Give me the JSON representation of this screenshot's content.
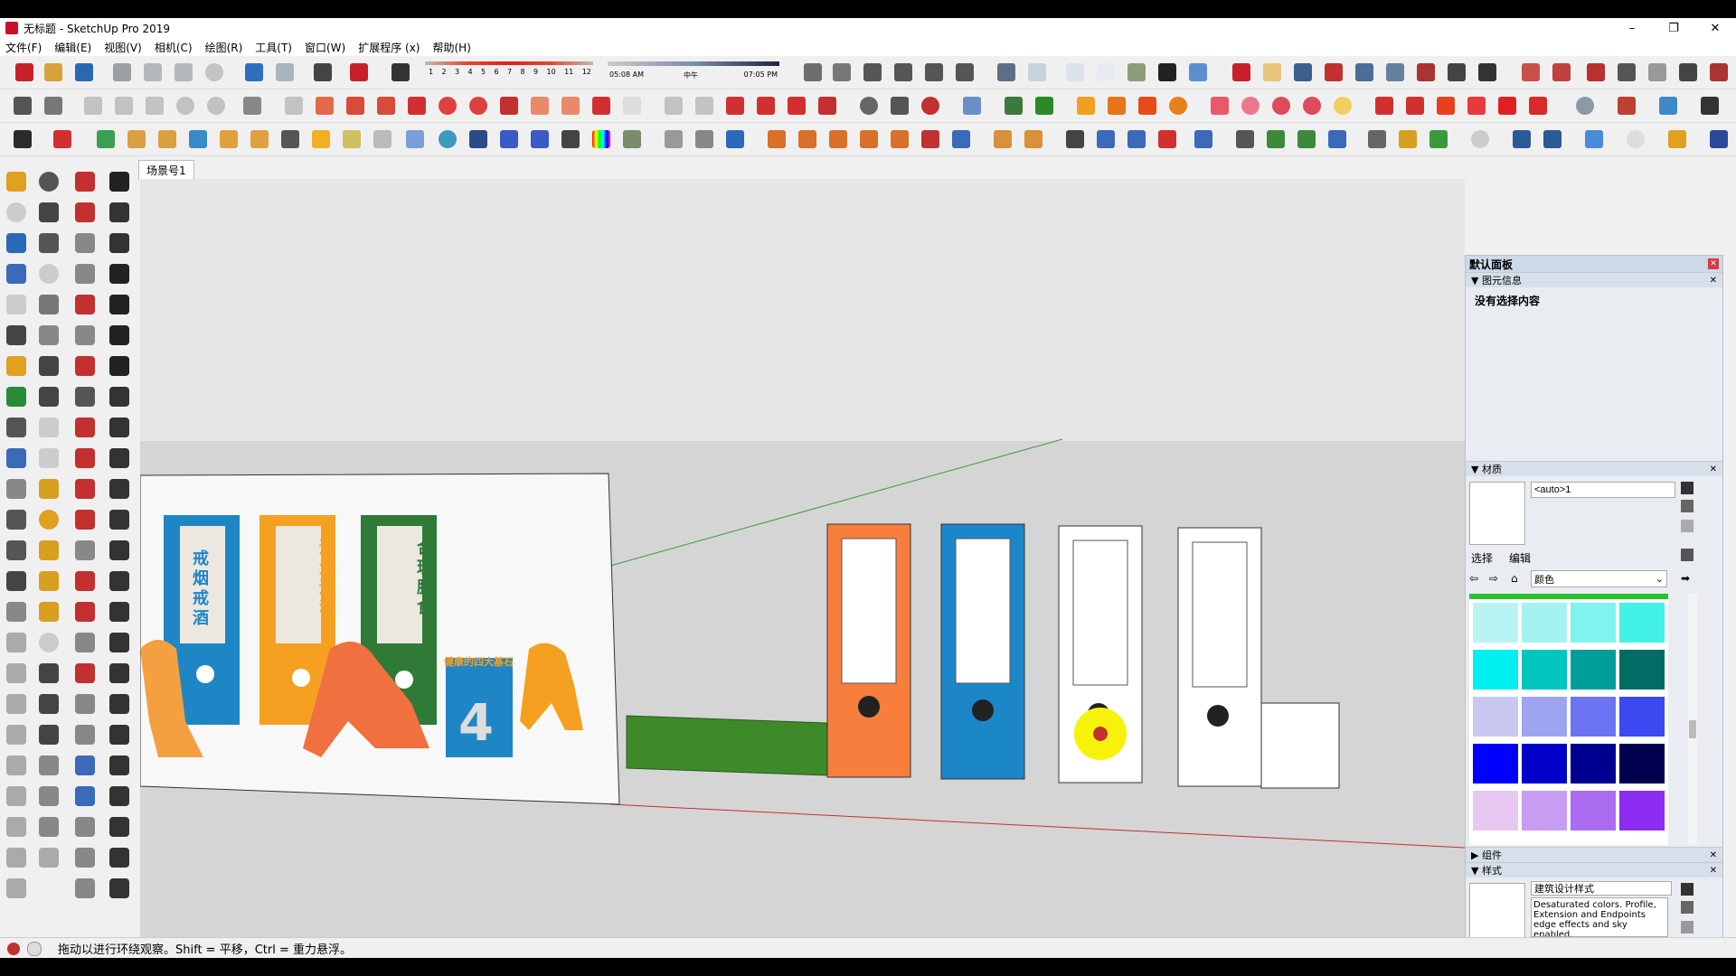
{
  "window": {
    "title": "无标题 - SketchUp Pro 2019",
    "minimize": "–",
    "maximize": "❐",
    "close": "✕"
  },
  "menu": [
    "文件(F)",
    "编辑(E)",
    "视图(V)",
    "相机(C)",
    "绘图(R)",
    "工具(T)",
    "窗口(W)",
    "扩展程序 (x)",
    "帮助(H)"
  ],
  "shadow": {
    "months": [
      "1",
      "2",
      "3",
      "4",
      "5",
      "6",
      "7",
      "8",
      "9",
      "10",
      "11",
      "12"
    ],
    "time_start": "05:08 AM",
    "time_mid": "中午",
    "time_end": "07:05 PM"
  },
  "scene_tab": "场景号1",
  "panel": {
    "title": "默认面板",
    "entity_info": {
      "header": "图元信息",
      "content": "没有选择内容"
    },
    "materials": {
      "header": "材质",
      "material_name": "<auto>1",
      "tabs": [
        "选择",
        "编辑"
      ],
      "library": "颜色"
    },
    "components": {
      "header": "组件"
    },
    "styles": {
      "header": "样式",
      "style_name": "建筑设计样式",
      "style_desc": "Desaturated colors. Profile, Extension and Endpoints edge effects and sky enabled."
    }
  },
  "board_text": {
    "panel1": "戒烟戒酒",
    "panel2": "适量运动",
    "panel3": "合理膳食",
    "banner": "健康的四大基石",
    "number": "4"
  },
  "status": {
    "text": "拖动以进行环绕观察。Shift = 平移，Ctrl = 重力悬浮。"
  },
  "swatches": [
    "#b9f4f4",
    "#a5f2f2",
    "#7ff4ee",
    "#42f2e6",
    "#00f0f0",
    "#00c6c0",
    "#009e98",
    "#006c64",
    "#c8c8f0",
    "#9ea4f2",
    "#6c74f2",
    "#3c48f0",
    "#0000ff",
    "#0000c8",
    "#000090",
    "#00004e",
    "#e6c8f2",
    "#c89cf2",
    "#ab6cf2",
    "#8c2cf0"
  ],
  "colors": {
    "panel_blue": "#1f86c6",
    "panel_orange": "#f5a020",
    "panel_green": "#2f7a36",
    "door_orange": "#f77e3c",
    "door_blue": "#1b87c9",
    "bench_green": "#3e8a2a"
  }
}
